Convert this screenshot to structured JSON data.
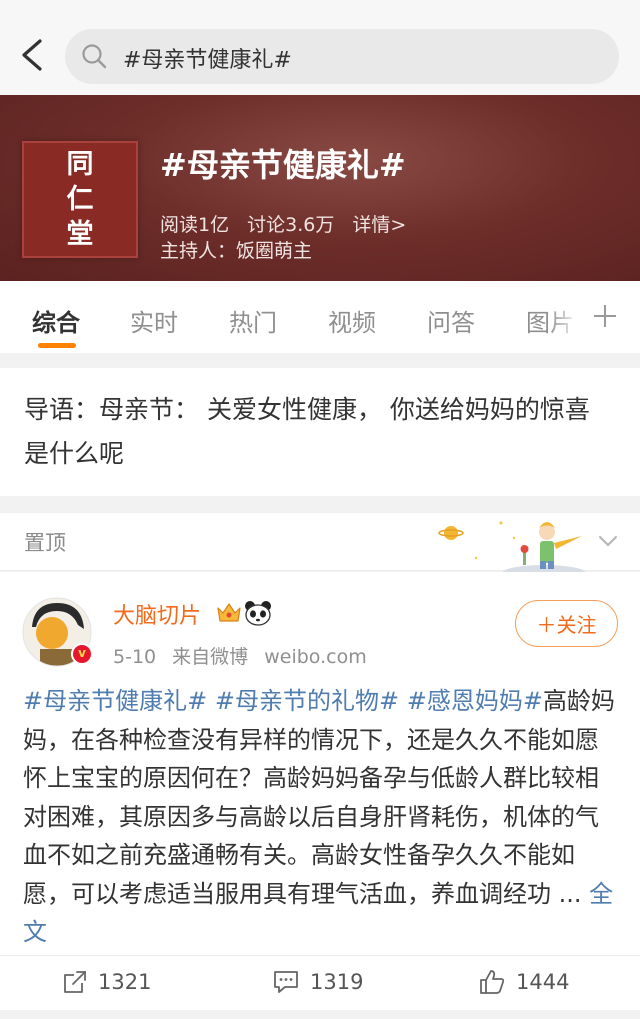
{
  "search": {
    "query": "#母亲节健康礼#"
  },
  "topic": {
    "logo_lines": [
      "同",
      "仁",
      "堂"
    ],
    "title": "#母亲节健康礼#",
    "reads": "阅读1亿",
    "discussions": "讨论3.6万",
    "details": "详情>",
    "host": "主持人：饭圈萌主"
  },
  "tabs": [
    {
      "label": "综合"
    },
    {
      "label": "实时"
    },
    {
      "label": "热门"
    },
    {
      "label": "视频"
    },
    {
      "label": "问答"
    },
    {
      "label": "图片"
    }
  ],
  "guide": {
    "text": "导语：母亲节： 关爱女性健康， 你送给妈妈的惊喜是什么呢"
  },
  "pinned": {
    "label": "置顶"
  },
  "post": {
    "username": "大脑切片",
    "date": "5-10",
    "source": "来自微博",
    "site": "weibo.com",
    "follow_label": "＋关注",
    "tags": [
      "#母亲节健康礼#",
      "#母亲节的礼物#",
      "#感恩妈妈#"
    ],
    "text": "高龄妈妈，在各种检查没有异样的情况下，还是久久不能如愿怀上宝宝的原因何在？高龄妈妈备孕与低龄人群比较相对困难，其原因多与高龄以后自身肝肾耗伤，机体的气血不如之前充盛通畅有关。高龄女性备孕久久不能如愿，可以考虑适当服用具有理气活血，养血调经功",
    "ellipsis": " ...",
    "more": "全文",
    "reposts": "1321",
    "comments": "1319",
    "likes": "1444"
  },
  "colors": {
    "accent": "#ff8200",
    "link": "#507daf",
    "username": "#f26b1d",
    "banner": "#6e2e2a"
  },
  "icons": [
    "back-arrow-icon",
    "search-icon",
    "plus-icon",
    "chevron-down-icon",
    "crown-icon",
    "panda-icon",
    "verified-icon",
    "repost-icon",
    "comment-icon",
    "like-icon"
  ]
}
